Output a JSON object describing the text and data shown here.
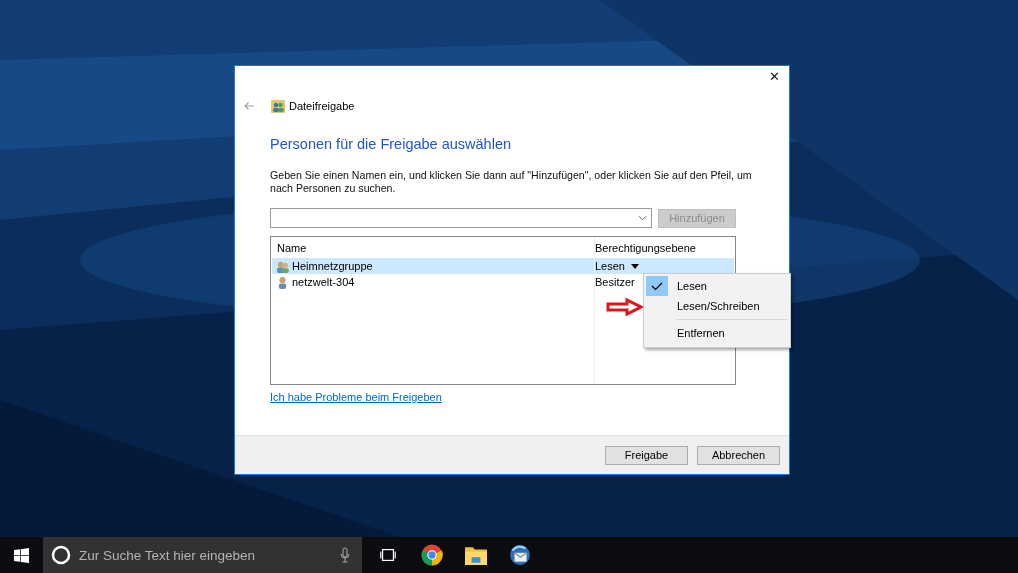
{
  "dialog": {
    "close": "✕",
    "title": "Dateifreigabe",
    "heading": "Personen für die Freigabe auswählen",
    "instructions": "Geben Sie einen Namen ein, und klicken Sie dann auf \"Hinzufügen\", oder klicken Sie auf den Pfeil, um nach Personen zu suchen.",
    "add_button": {
      "label": "Hinzufügen",
      "disabled": true
    },
    "table": {
      "columns": [
        "Name",
        "Berechtigungsebene"
      ],
      "rows": [
        {
          "name": "Heimnetzgruppe",
          "kind": "group",
          "permission": "Lesen",
          "dropdown": true,
          "selected": true
        },
        {
          "name": "netzwelt-304",
          "kind": "user",
          "permission": "Besitzer",
          "dropdown": false,
          "selected": false
        }
      ]
    },
    "link": "Ich habe Probleme beim Freigeben",
    "buttons": [
      "Freigabe",
      "Abbrechen"
    ]
  },
  "context_menu": {
    "items": [
      {
        "label": "Lesen",
        "checked": true,
        "separator_before": false
      },
      {
        "label": "Lesen/Schreiben",
        "checked": false,
        "separator_before": false
      },
      {
        "label": "Entfernen",
        "checked": false,
        "separator_before": true
      }
    ]
  },
  "taskbar": {
    "search_placeholder": "Zur Suche Text hier eingeben"
  }
}
